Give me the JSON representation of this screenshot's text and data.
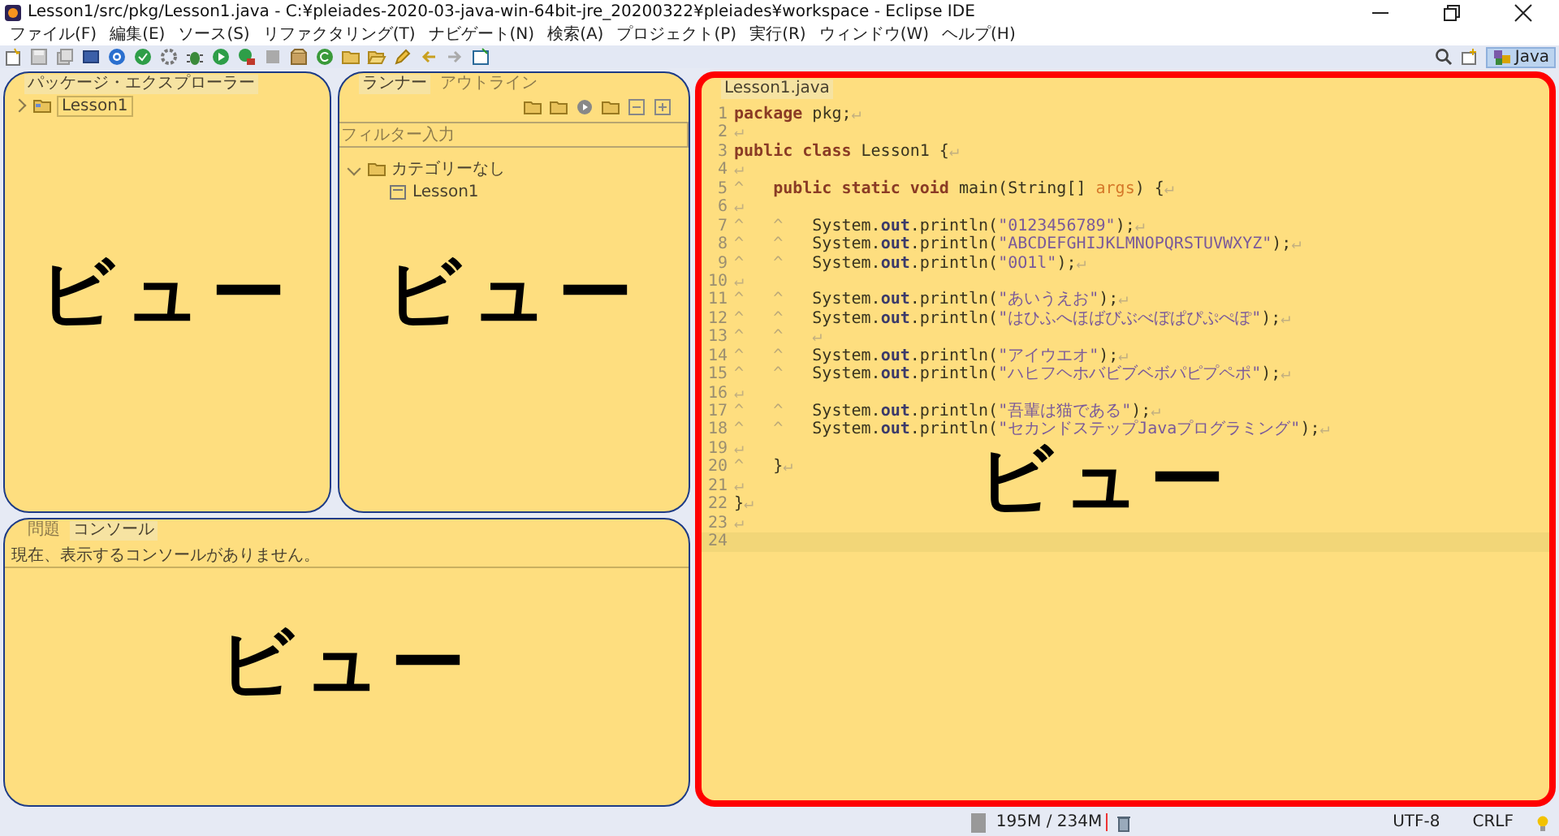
{
  "window": {
    "title": "Lesson1/src/pkg/Lesson1.java - C:¥pleiades-2020-03-java-win-64bit-jre_20200322¥pleiades¥workspace - Eclipse IDE"
  },
  "menu": [
    "ファイル(F)",
    "編集(E)",
    "ソース(S)",
    "リファクタリング(T)",
    "ナビゲート(N)",
    "検索(A)",
    "プロジェクト(P)",
    "実行(R)",
    "ウィンドウ(W)",
    "ヘルプ(H)"
  ],
  "perspective": {
    "label": "Java",
    "selected": true
  },
  "package_explorer": {
    "callout": "ビュー",
    "tabs": [
      {
        "label": "パッケージ・エクスプローラー",
        "selected": true
      }
    ],
    "tree": [
      {
        "label": "Lesson1",
        "expanded": false
      }
    ]
  },
  "runner": {
    "callout": "ビュー",
    "tabs": [
      {
        "label": "ランナー",
        "selected": true
      },
      {
        "label": "アウトライン",
        "selected": false
      }
    ],
    "filter": {
      "placeholder": "フィルター入力"
    },
    "tree": [
      {
        "label": "カテゴリーなし",
        "expanded": true,
        "children": [
          {
            "label": "Lesson1"
          }
        ]
      }
    ]
  },
  "console": {
    "callout": "ビュー",
    "tabs": [
      {
        "label": "問題",
        "selected": false
      },
      {
        "label": "コンソール",
        "selected": true
      }
    ],
    "message": "現在、表示するコンソールがありません。"
  },
  "editor": {
    "callout": "ビュー",
    "emphasized": true,
    "tabs": [
      {
        "label": "Lesson1.java",
        "selected": true
      }
    ],
    "lines": [
      {
        "number": "1",
        "current": false,
        "tokens": [
          {
            "kind": "keyword",
            "text": "package"
          },
          {
            "kind": "plain",
            "text": " pkg;"
          },
          {
            "kind": "eol",
            "text": "↵"
          }
        ]
      },
      {
        "number": "2",
        "current": false,
        "tokens": [
          {
            "kind": "eol",
            "text": "↵"
          }
        ]
      },
      {
        "number": "3",
        "current": false,
        "tokens": [
          {
            "kind": "keyword",
            "text": "public class"
          },
          {
            "kind": "plain",
            "text": " Lesson1 {"
          },
          {
            "kind": "eol",
            "text": "↵"
          }
        ]
      },
      {
        "number": "4",
        "current": false,
        "tokens": [
          {
            "kind": "eol",
            "text": "↵"
          }
        ]
      },
      {
        "number": "5",
        "current": false,
        "tokens": [
          {
            "kind": "tab",
            "text": "^"
          },
          {
            "kind": "keyword",
            "text": "public static void"
          },
          {
            "kind": "plain",
            "text": " main(String[] "
          },
          {
            "kind": "param",
            "text": "args"
          },
          {
            "kind": "plain",
            "text": ") {"
          },
          {
            "kind": "eol",
            "text": "↵"
          }
        ]
      },
      {
        "number": "6",
        "current": false,
        "tokens": [
          {
            "kind": "eol",
            "text": "↵"
          }
        ]
      },
      {
        "number": "7",
        "current": false,
        "tokens": [
          {
            "kind": "tab",
            "text": "^"
          },
          {
            "kind": "tab",
            "text": "^"
          },
          {
            "kind": "plain",
            "text": "System."
          },
          {
            "kind": "field",
            "text": "out"
          },
          {
            "kind": "plain",
            "text": ".println("
          },
          {
            "kind": "string",
            "text": "\"0123456789\""
          },
          {
            "kind": "plain",
            "text": ");"
          },
          {
            "kind": "eol",
            "text": "↵"
          }
        ]
      },
      {
        "number": "8",
        "current": false,
        "tokens": [
          {
            "kind": "tab",
            "text": "^"
          },
          {
            "kind": "tab",
            "text": "^"
          },
          {
            "kind": "plain",
            "text": "System."
          },
          {
            "kind": "field",
            "text": "out"
          },
          {
            "kind": "plain",
            "text": ".println("
          },
          {
            "kind": "string",
            "text": "\"ABCDEFGHIJKLMNOPQRSTUVWXYZ\""
          },
          {
            "kind": "plain",
            "text": ");"
          },
          {
            "kind": "eol",
            "text": "↵"
          }
        ]
      },
      {
        "number": "9",
        "current": false,
        "tokens": [
          {
            "kind": "tab",
            "text": "^"
          },
          {
            "kind": "tab",
            "text": "^"
          },
          {
            "kind": "plain",
            "text": "System."
          },
          {
            "kind": "field",
            "text": "out"
          },
          {
            "kind": "plain",
            "text": ".println("
          },
          {
            "kind": "string",
            "text": "\"0O1l\""
          },
          {
            "kind": "plain",
            "text": ");"
          },
          {
            "kind": "eol",
            "text": "↵"
          }
        ]
      },
      {
        "number": "10",
        "current": false,
        "tokens": [
          {
            "kind": "eol",
            "text": "↵"
          }
        ]
      },
      {
        "number": "11",
        "current": false,
        "tokens": [
          {
            "kind": "tab",
            "text": "^"
          },
          {
            "kind": "tab",
            "text": "^"
          },
          {
            "kind": "plain",
            "text": "System."
          },
          {
            "kind": "field",
            "text": "out"
          },
          {
            "kind": "plain",
            "text": ".println("
          },
          {
            "kind": "string",
            "text": "\"あいうえお\""
          },
          {
            "kind": "plain",
            "text": ");"
          },
          {
            "kind": "eol",
            "text": "↵"
          }
        ]
      },
      {
        "number": "12",
        "current": false,
        "tokens": [
          {
            "kind": "tab",
            "text": "^"
          },
          {
            "kind": "tab",
            "text": "^"
          },
          {
            "kind": "plain",
            "text": "System."
          },
          {
            "kind": "field",
            "text": "out"
          },
          {
            "kind": "plain",
            "text": ".println("
          },
          {
            "kind": "string",
            "text": "\"はひふへほばびぶべぼぱぴぷぺぽ\""
          },
          {
            "kind": "plain",
            "text": ");"
          },
          {
            "kind": "eol",
            "text": "↵"
          }
        ]
      },
      {
        "number": "13",
        "current": false,
        "tokens": [
          {
            "kind": "tab",
            "text": "^"
          },
          {
            "kind": "tab",
            "text": "^"
          },
          {
            "kind": "eol",
            "text": "↵"
          }
        ]
      },
      {
        "number": "14",
        "current": false,
        "tokens": [
          {
            "kind": "tab",
            "text": "^"
          },
          {
            "kind": "tab",
            "text": "^"
          },
          {
            "kind": "plain",
            "text": "System."
          },
          {
            "kind": "field",
            "text": "out"
          },
          {
            "kind": "plain",
            "text": ".println("
          },
          {
            "kind": "string",
            "text": "\"アイウエオ\""
          },
          {
            "kind": "plain",
            "text": ");"
          },
          {
            "kind": "eol",
            "text": "↵"
          }
        ]
      },
      {
        "number": "15",
        "current": false,
        "tokens": [
          {
            "kind": "tab",
            "text": "^"
          },
          {
            "kind": "tab",
            "text": "^"
          },
          {
            "kind": "plain",
            "text": "System."
          },
          {
            "kind": "field",
            "text": "out"
          },
          {
            "kind": "plain",
            "text": ".println("
          },
          {
            "kind": "string",
            "text": "\"ハヒフヘホバビブベボパピプペポ\""
          },
          {
            "kind": "plain",
            "text": ");"
          },
          {
            "kind": "eol",
            "text": "↵"
          }
        ]
      },
      {
        "number": "16",
        "current": false,
        "tokens": [
          {
            "kind": "eol",
            "text": "↵"
          }
        ]
      },
      {
        "number": "17",
        "current": false,
        "tokens": [
          {
            "kind": "tab",
            "text": "^"
          },
          {
            "kind": "tab",
            "text": "^"
          },
          {
            "kind": "plain",
            "text": "System."
          },
          {
            "kind": "field",
            "text": "out"
          },
          {
            "kind": "plain",
            "text": ".println("
          },
          {
            "kind": "string",
            "text": "\"吾輩は猫である\""
          },
          {
            "kind": "plain",
            "text": ");"
          },
          {
            "kind": "eol",
            "text": "↵"
          }
        ]
      },
      {
        "number": "18",
        "current": false,
        "tokens": [
          {
            "kind": "tab",
            "text": "^"
          },
          {
            "kind": "tab",
            "text": "^"
          },
          {
            "kind": "plain",
            "text": "System."
          },
          {
            "kind": "field",
            "text": "out"
          },
          {
            "kind": "plain",
            "text": ".println("
          },
          {
            "kind": "string",
            "text": "\"セカンドステップJavaプログラミング\""
          },
          {
            "kind": "plain",
            "text": ");"
          },
          {
            "kind": "eol",
            "text": "↵"
          }
        ]
      },
      {
        "number": "19",
        "current": false,
        "tokens": [
          {
            "kind": "eol",
            "text": "↵"
          }
        ]
      },
      {
        "number": "20",
        "current": false,
        "tokens": [
          {
            "kind": "tab",
            "text": "^"
          },
          {
            "kind": "plain",
            "text": "}"
          },
          {
            "kind": "eol",
            "text": "↵"
          }
        ]
      },
      {
        "number": "21",
        "current": false,
        "tokens": [
          {
            "kind": "eol",
            "text": "↵"
          }
        ]
      },
      {
        "number": "22",
        "current": false,
        "tokens": [
          {
            "kind": "plain",
            "text": "}"
          },
          {
            "kind": "eol",
            "text": "↵"
          }
        ]
      },
      {
        "number": "23",
        "current": false,
        "tokens": [
          {
            "kind": "eol",
            "text": "↵"
          }
        ]
      },
      {
        "number": "24",
        "current": true
      }
    ]
  },
  "status_bar": {
    "memory": "195M / 234M",
    "encoding": "UTF-8",
    "line_delimiter": "CRLF"
  }
}
